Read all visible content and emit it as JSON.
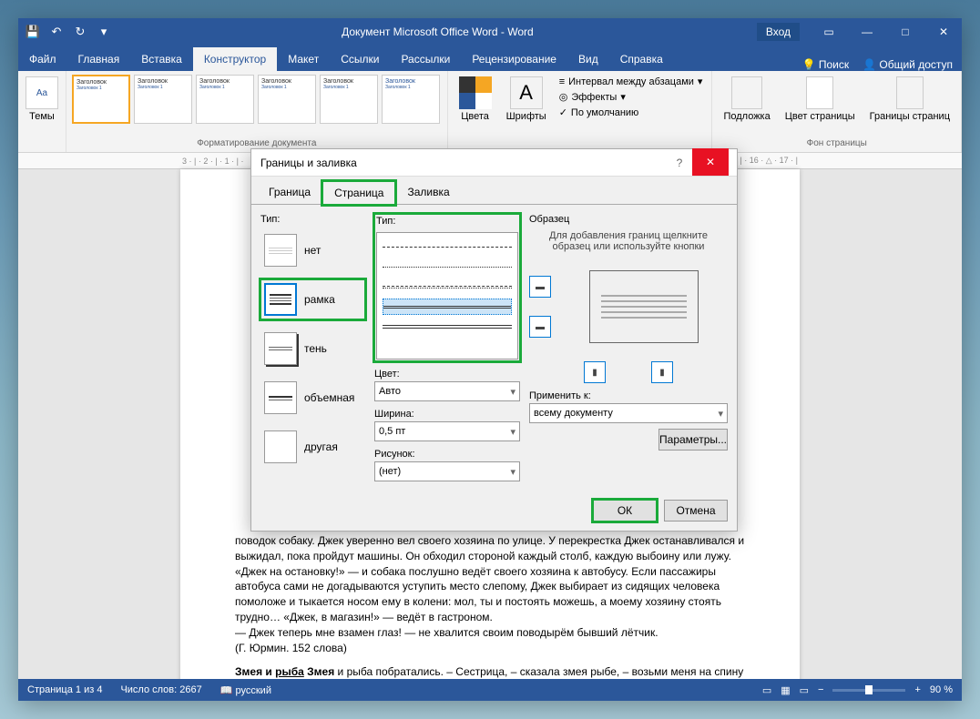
{
  "titlebar": {
    "title": "Документ Microsoft Office Word  -  Word",
    "login": "Вход"
  },
  "tabs": {
    "file": "Файл",
    "home": "Главная",
    "insert": "Вставка",
    "design": "Конструктор",
    "layout": "Макет",
    "references": "Ссылки",
    "mailings": "Рассылки",
    "review": "Рецензирование",
    "view": "Вид",
    "help": "Справка",
    "search": "Поиск",
    "share": "Общий доступ"
  },
  "ribbon": {
    "themes": "Темы",
    "style_heading": "Заголовок",
    "style_heading1": "Заголовок 1",
    "format_doc": "Форматирование документа",
    "colors": "Цвета",
    "fonts": "Шрифты",
    "para_spacing": "Интервал между абзацами",
    "effects": "Эффекты",
    "default": "По умолчанию",
    "watermark": "Подложка",
    "page_color": "Цвет страницы",
    "page_borders": "Границы страниц",
    "page_background": "Фон страницы"
  },
  "dialog": {
    "title": "Границы и заливка",
    "tab_border": "Граница",
    "tab_page": "Страница",
    "tab_fill": "Заливка",
    "type_label": "Тип:",
    "style_label": "Тип:",
    "preview_label": "Образец",
    "type_none": "нет",
    "type_box": "рамка",
    "type_shadow": "тень",
    "type_3d": "объемная",
    "type_custom": "другая",
    "color_label": "Цвет:",
    "color_value": "Авто",
    "width_label": "Ширина:",
    "width_value": "0,5 пт",
    "art_label": "Рисунок:",
    "art_value": "(нет)",
    "preview_hint": "Для добавления границ щелкните образец или используйте кнопки",
    "apply_label": "Применить к:",
    "apply_value": "всему документу",
    "params": "Параметры...",
    "ok": "ОК",
    "cancel": "Отмена"
  },
  "doc": {
    "p1": "поводок собаку. Джек уверенно вел своего хозяина по улице. У перекрестка Джек останавливался и выжидал, пока пройдут машины. Он обходил стороной каждый столб, каждую выбоину или лужу. «Джек на остановку!» — и собака послушно ведёт своего хозяина к автобусу. Если пассажиры автобуса сами не догадываются уступить место слепому, Джек выбирает из сидящих человека помоложе и тыкается носом ему в колени: мол, ты и постоять можешь, а моему хозяину стоять трудно… «Джек, в магазин!» — ведёт в гастроном.",
    "p2": "— Джек теперь мне взамен глаз! — не хвалится своим поводырём бывший лётчик.",
    "p3": "(Г. Юрмин. 152 слова)",
    "p4a": "Змея и ",
    "p4b": "рыба",
    "p4c": " Змея",
    "p4d": " и рыба побратались. – Сестрица, – сказала змея рыбе, – возьми меня на спину и покатай по морю. – Хорошо, – ответила рыба, – садись мне на спину, я покатаю тебя;"
  },
  "statusbar": {
    "page": "Страница 1 из 4",
    "words": "Число слов: 2667",
    "lang": "русский",
    "zoom": "90 %"
  },
  "ruler": {
    "left": "3 · | · 2 · | · 1 · | ·",
    "right": "· | · 16 · △ · 17 · |"
  }
}
